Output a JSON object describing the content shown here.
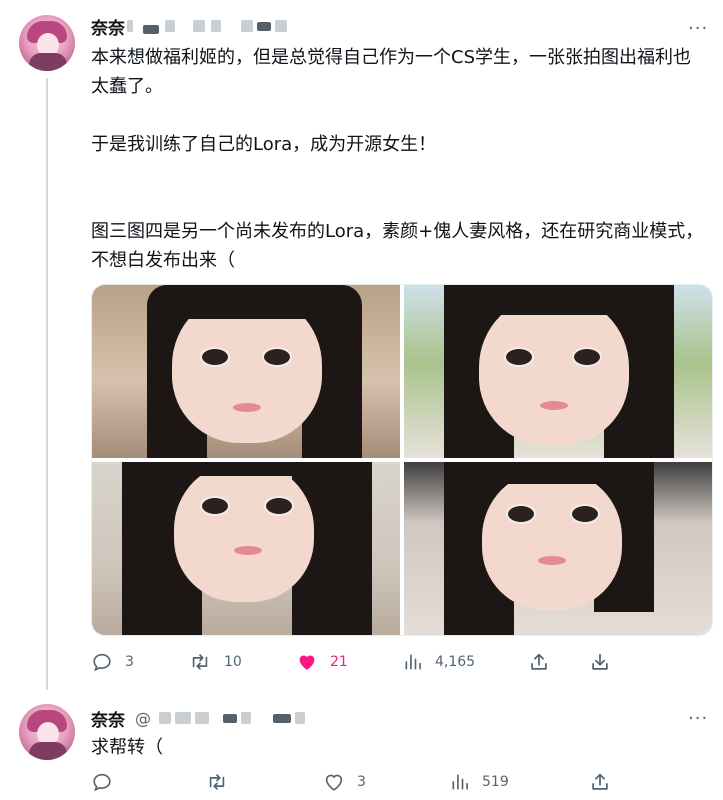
{
  "tweet1": {
    "author_name": "奈奈",
    "menu_glyph": "···",
    "paragraphs": [
      "本来想做福利姬的，但是总觉得自己作为一个CS学生，一张张拍图出福利也太蠢了。",
      "于是我训练了自己的Lora，成为开源女生！",
      "图三图四是另一个尚未发布的Lora，素颜+傀人妻风格，还在研究商业模式，不想白发布出来（"
    ],
    "actions": {
      "reply_count": "3",
      "retweet_count": "10",
      "like_count": "21",
      "views_count": "4,165"
    },
    "like_color": "#f91880"
  },
  "tweet2": {
    "author_name": "奈奈",
    "handle_prefix": "@",
    "menu_glyph": "···",
    "text": "求帮转（",
    "actions": {
      "reply_count": "",
      "retweet_count": "",
      "like_count": "3",
      "views_count": "519"
    }
  },
  "icons": {
    "reply": "reply-icon",
    "retweet": "retweet-icon",
    "like": "heart-icon",
    "views": "views-icon",
    "share": "share-icon",
    "bookmark": "download-icon"
  }
}
